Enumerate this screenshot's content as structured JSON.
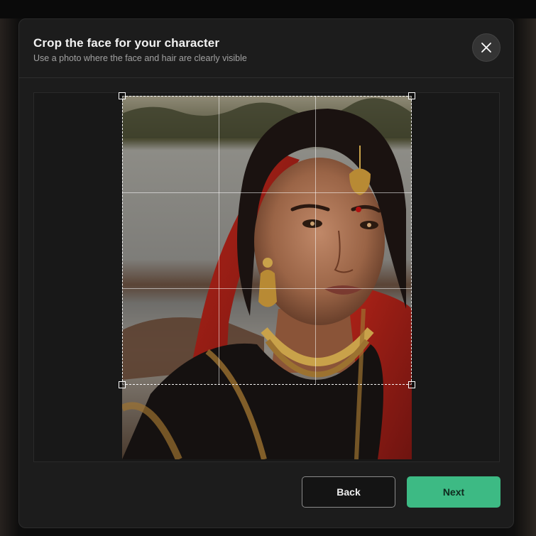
{
  "dialog": {
    "title": "Crop the face for your character",
    "subtitle": "Use a photo where the face and hair are clearly visible",
    "close_icon": "close-icon"
  },
  "actions": {
    "back_label": "Back",
    "next_label": "Next"
  },
  "colors": {
    "accent": "#3dba84",
    "modal_bg": "#1c1c1c",
    "backdrop": "#0b0b0b"
  }
}
